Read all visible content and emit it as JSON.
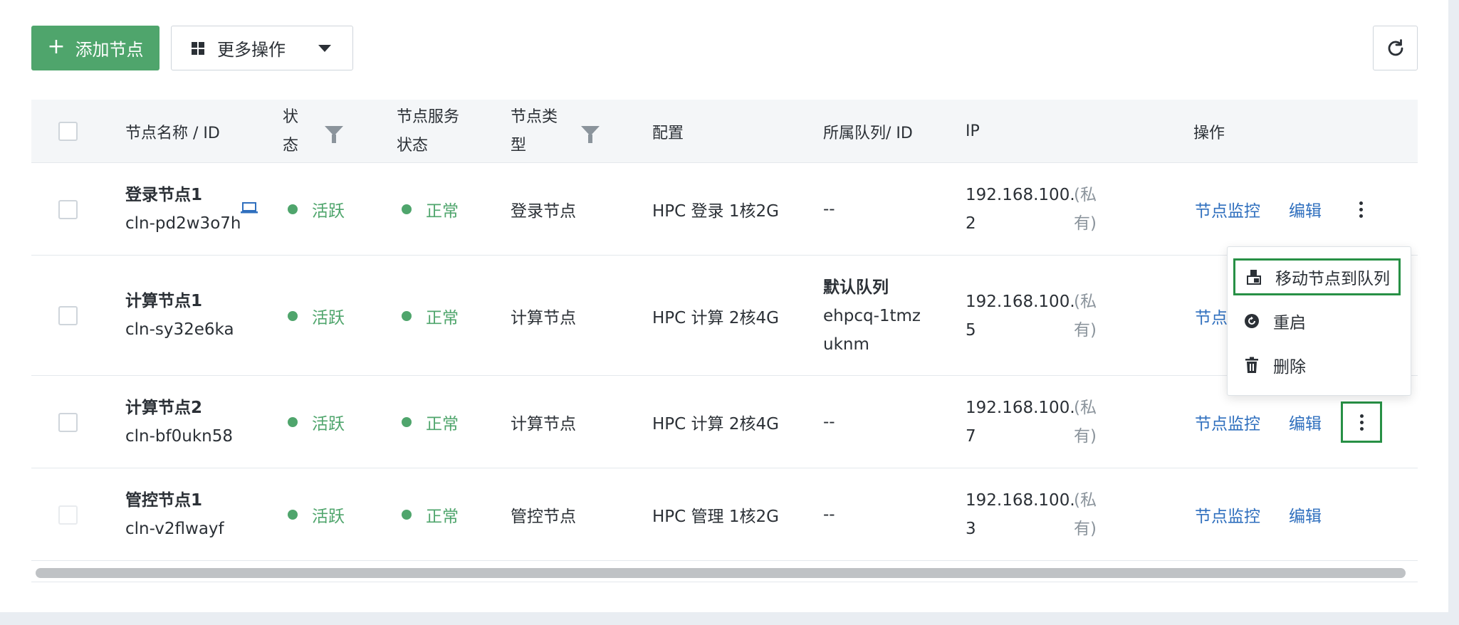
{
  "toolbar": {
    "add_label": "添加节点",
    "add_icon": "plus-icon",
    "more_label": "更多操作",
    "refresh_icon": "refresh-icon"
  },
  "columns": {
    "name": "节点名称 / ID",
    "status_l1": "状",
    "status_l2": "态",
    "service_l1": "节点服务",
    "service_l2": "状态",
    "type_l1": "节点类",
    "type_l2": "型",
    "config": "配置",
    "queue": "所属队列/ ID",
    "ip": "IP",
    "ops": "操作"
  },
  "rows": [
    {
      "name": "登录节点1",
      "id": "cln-pd2w3o7h",
      "status": "活跃",
      "service": "正常",
      "type": "登录节点",
      "config": "HPC 登录 1核2G",
      "queue_name": "",
      "queue_l1": "--",
      "queue_l2": "",
      "ip_l1": "192.168.100.",
      "ip_l2": "2",
      "ip_tag_l1": "(私",
      "ip_tag_l2": "有)",
      "monitor": "节点监控",
      "edit": "编辑"
    },
    {
      "name": "计算节点1",
      "id": "cln-sy32e6ka",
      "status": "活跃",
      "service": "正常",
      "type": "计算节点",
      "config": "HPC 计算 2核4G",
      "queue_name": "默认队列",
      "queue_l1": "ehpcq-1tmz",
      "queue_l2": "uknm",
      "ip_l1": "192.168.100.",
      "ip_l2": "5",
      "ip_tag_l1": "(私",
      "ip_tag_l2": "有)",
      "monitor": "节点",
      "edit": ""
    },
    {
      "name": "计算节点2",
      "id": "cln-bf0ukn58",
      "status": "活跃",
      "service": "正常",
      "type": "计算节点",
      "config": "HPC 计算 2核4G",
      "queue_name": "",
      "queue_l1": "--",
      "queue_l2": "",
      "ip_l1": "192.168.100.",
      "ip_l2": "7",
      "ip_tag_l1": "(私",
      "ip_tag_l2": "有)",
      "monitor": "节点监控",
      "edit": "编辑"
    },
    {
      "name": "管控节点1",
      "id": "cln-v2flwayf",
      "status": "活跃",
      "service": "正常",
      "type": "管控节点",
      "config": "HPC 管理 1核2G",
      "queue_name": "",
      "queue_l1": "--",
      "queue_l2": "",
      "ip_l1": "192.168.100.",
      "ip_l2": "3",
      "ip_tag_l1": "(私",
      "ip_tag_l2": "有)",
      "monitor": "节点监控",
      "edit": "编辑"
    }
  ],
  "menu": {
    "move": "移动节点到队列",
    "restart": "重启",
    "delete": "删除"
  },
  "colors": {
    "primary": "#4fa56c",
    "link": "#2f6fbe",
    "highlight": "#279045"
  }
}
